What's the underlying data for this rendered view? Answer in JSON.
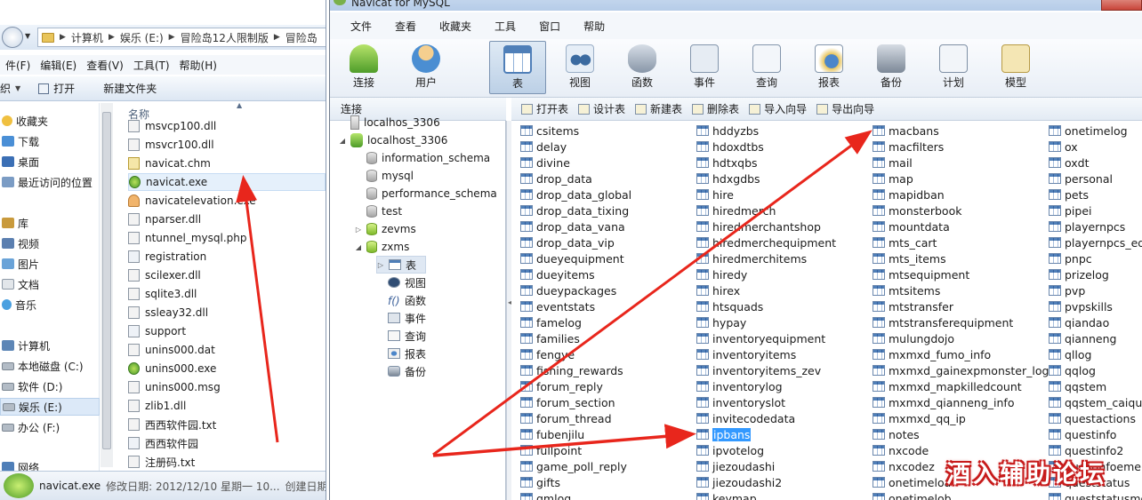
{
  "explorer": {
    "address_crumbs": [
      "计算机",
      "娱乐 (E:)",
      "冒险岛12人限制版",
      "冒险岛"
    ],
    "menu": [
      "件(F)",
      "编辑(E)",
      "查看(V)",
      "工具(T)",
      "帮助(H)"
    ],
    "toolbar": {
      "organize": "织",
      "open": "打开",
      "new_folder": "新建文件夹"
    },
    "nav": [
      {
        "label": "收藏夹",
        "icon": "star-icon"
      },
      {
        "label": "下载",
        "icon": "download-folder-icon"
      },
      {
        "label": "桌面",
        "icon": "desktop-icon"
      },
      {
        "label": "最近访问的位置",
        "icon": "recent-places-icon"
      },
      {
        "label": "库",
        "icon": "library-icon"
      },
      {
        "label": "视频",
        "icon": "video-library-icon"
      },
      {
        "label": "图片",
        "icon": "pictures-library-icon"
      },
      {
        "label": "文档",
        "icon": "documents-library-icon"
      },
      {
        "label": "音乐",
        "icon": "music-library-icon"
      },
      {
        "label": "计算机",
        "icon": "computer-icon"
      },
      {
        "label": "本地磁盘 (C:)",
        "icon": "drive-icon"
      },
      {
        "label": "软件 (D:)",
        "icon": "drive-icon"
      },
      {
        "label": "娱乐 (E:)",
        "icon": "drive-icon"
      },
      {
        "label": "办公 (F:)",
        "icon": "drive-icon"
      },
      {
        "label": "网络",
        "icon": "network-icon"
      }
    ],
    "column_header": "名称",
    "files": [
      {
        "name": "msvcp100.dll",
        "icon": "dll-file-icon"
      },
      {
        "name": "msvcr100.dll",
        "icon": "dll-file-icon"
      },
      {
        "name": "navicat.chm",
        "icon": "help-file-icon"
      },
      {
        "name": "navicat.exe",
        "icon": "navicat-exe-icon"
      },
      {
        "name": "navicatelevation.exe",
        "icon": "navicatelevation-exe-icon"
      },
      {
        "name": "nparser.dll",
        "icon": "dll-file-icon"
      },
      {
        "name": "ntunnel_mysql.php",
        "icon": "php-file-icon"
      },
      {
        "name": "registration",
        "icon": "shortcut-icon"
      },
      {
        "name": "scilexer.dll",
        "icon": "dll-file-icon"
      },
      {
        "name": "sqlite3.dll",
        "icon": "dll-file-icon"
      },
      {
        "name": "ssleay32.dll",
        "icon": "dll-file-icon"
      },
      {
        "name": "support",
        "icon": "shortcut-icon"
      },
      {
        "name": "unins000.dat",
        "icon": "dat-file-icon"
      },
      {
        "name": "unins000.exe",
        "icon": "uninstall-exe-icon"
      },
      {
        "name": "unins000.msg",
        "icon": "msg-file-icon"
      },
      {
        "name": "zlib1.dll",
        "icon": "dll-file-icon"
      },
      {
        "name": "西西软件园.txt",
        "icon": "text-file-icon"
      },
      {
        "name": "西西软件园",
        "icon": "shortcut-icon"
      },
      {
        "name": "注册码.txt",
        "icon": "text-file-icon"
      }
    ],
    "status": {
      "name": "navicat.exe",
      "modified": "修改日期: 2012/12/10 星期一 10...",
      "created": "创建日期:"
    }
  },
  "navicat": {
    "title": "Navicat for MySQL",
    "menu": [
      "文件",
      "查看",
      "收藏夹",
      "工具",
      "窗口",
      "帮助"
    ],
    "toolbar": [
      {
        "label": "连接",
        "icon": "connection-icon"
      },
      {
        "label": "用户",
        "icon": "user-icon"
      },
      {
        "label": "表",
        "icon": "table-icon"
      },
      {
        "label": "视图",
        "icon": "view-icon"
      },
      {
        "label": "函数",
        "icon": "function-icon"
      },
      {
        "label": "事件",
        "icon": "event-icon"
      },
      {
        "label": "查询",
        "icon": "query-icon"
      },
      {
        "label": "报表",
        "icon": "report-icon"
      },
      {
        "label": "备份",
        "icon": "backup-icon"
      },
      {
        "label": "计划",
        "icon": "schedule-icon"
      },
      {
        "label": "模型",
        "icon": "model-icon"
      }
    ],
    "active_tool": "表",
    "connections_header": "连接",
    "tree": [
      {
        "label": "localhos_3306",
        "level": 0,
        "type": "conn-grey",
        "toggle": ""
      },
      {
        "label": "localhost_3306",
        "level": 0,
        "type": "conn-green",
        "toggle": "◢"
      },
      {
        "label": "information_schema",
        "level": 1,
        "type": "db-grey",
        "toggle": ""
      },
      {
        "label": "mysql",
        "level": 1,
        "type": "db-grey",
        "toggle": ""
      },
      {
        "label": "performance_schema",
        "level": 1,
        "type": "db-grey",
        "toggle": ""
      },
      {
        "label": "test",
        "level": 1,
        "type": "db-grey",
        "toggle": ""
      },
      {
        "label": "zevms",
        "level": 1,
        "type": "db-green",
        "toggle": "▷"
      },
      {
        "label": "zxms",
        "level": 1,
        "type": "db-green",
        "toggle": "◢"
      },
      {
        "label": "表",
        "level": 2,
        "type": "obj-table",
        "toggle": "▷"
      },
      {
        "label": "视图",
        "level": 2,
        "type": "obj-view",
        "toggle": ""
      },
      {
        "label": "函数",
        "level": 2,
        "type": "obj-func",
        "toggle": ""
      },
      {
        "label": "事件",
        "level": 2,
        "type": "obj-event",
        "toggle": ""
      },
      {
        "label": "查询",
        "level": 2,
        "type": "obj-query",
        "toggle": ""
      },
      {
        "label": "报表",
        "level": 2,
        "type": "obj-report",
        "toggle": ""
      },
      {
        "label": "备份",
        "level": 2,
        "type": "obj-backup",
        "toggle": ""
      }
    ],
    "object_toolbar": [
      "打开表",
      "设计表",
      "新建表",
      "删除表",
      "导入向导",
      "导出向导"
    ],
    "tables": [
      [
        "csitems",
        "delay",
        "divine",
        "drop_data",
        "drop_data_global",
        "drop_data_tixing",
        "drop_data_vana",
        "drop_data_vip",
        "dueyequipment",
        "dueyitems",
        "dueypackages",
        "eventstats",
        "famelog",
        "families",
        "fengye",
        "fishing_rewards",
        "forum_reply",
        "forum_section",
        "forum_thread",
        "fubenjilu",
        "fullpoint",
        "game_poll_reply",
        "gifts",
        "gmlog"
      ],
      [
        "hddyzbs",
        "hdoxdtbs",
        "hdtxqbs",
        "hdxgdbs",
        "hire",
        "hiredmerch",
        "hiredmerchantshop",
        "hiredmerchequipment",
        "hiredmerchitems",
        "hiredy",
        "hirex",
        "htsquads",
        "hypay",
        "inventoryequipment",
        "inventoryitems",
        "inventoryitems_zev",
        "inventorylog",
        "inventoryslot",
        "invitecodedata",
        "ipbans",
        "ipvotelog",
        "jiezoudashi",
        "jiezoudashi2",
        "keymap"
      ],
      [
        "macbans",
        "macfilters",
        "mail",
        "map",
        "mapidban",
        "monsterbook",
        "mountdata",
        "mts_cart",
        "mts_items",
        "mtsequipment",
        "mtsitems",
        "mtstransfer",
        "mtstransferequipment",
        "mulungdojo",
        "mxmxd_fumo_info",
        "mxmxd_gainexpmonster_logs",
        "mxmxd_mapkilledcount",
        "mxmxd_qianneng_info",
        "mxmxd_qq_ip",
        "notes",
        "nxcode",
        "nxcodez",
        "onetimeloa",
        "onetimelob"
      ],
      [
        "onetimelog",
        "ox",
        "oxdt",
        "personal",
        "pets",
        "pipei",
        "playernpcs",
        "playernpcs_equ",
        "pnpc",
        "prizelog",
        "pvp",
        "pvpskills",
        "qiandao",
        "qianneng",
        "qllog",
        "qqlog",
        "qqstem",
        "qqstem_caiqua",
        "questactions",
        "questinfo",
        "questinfo2",
        "questinfoeme",
        "queststatus",
        "queststatusmob"
      ]
    ],
    "selected_table": "ipbans"
  },
  "watermark": "酒入辅助论坛",
  "annotation_color": "#e8261c"
}
